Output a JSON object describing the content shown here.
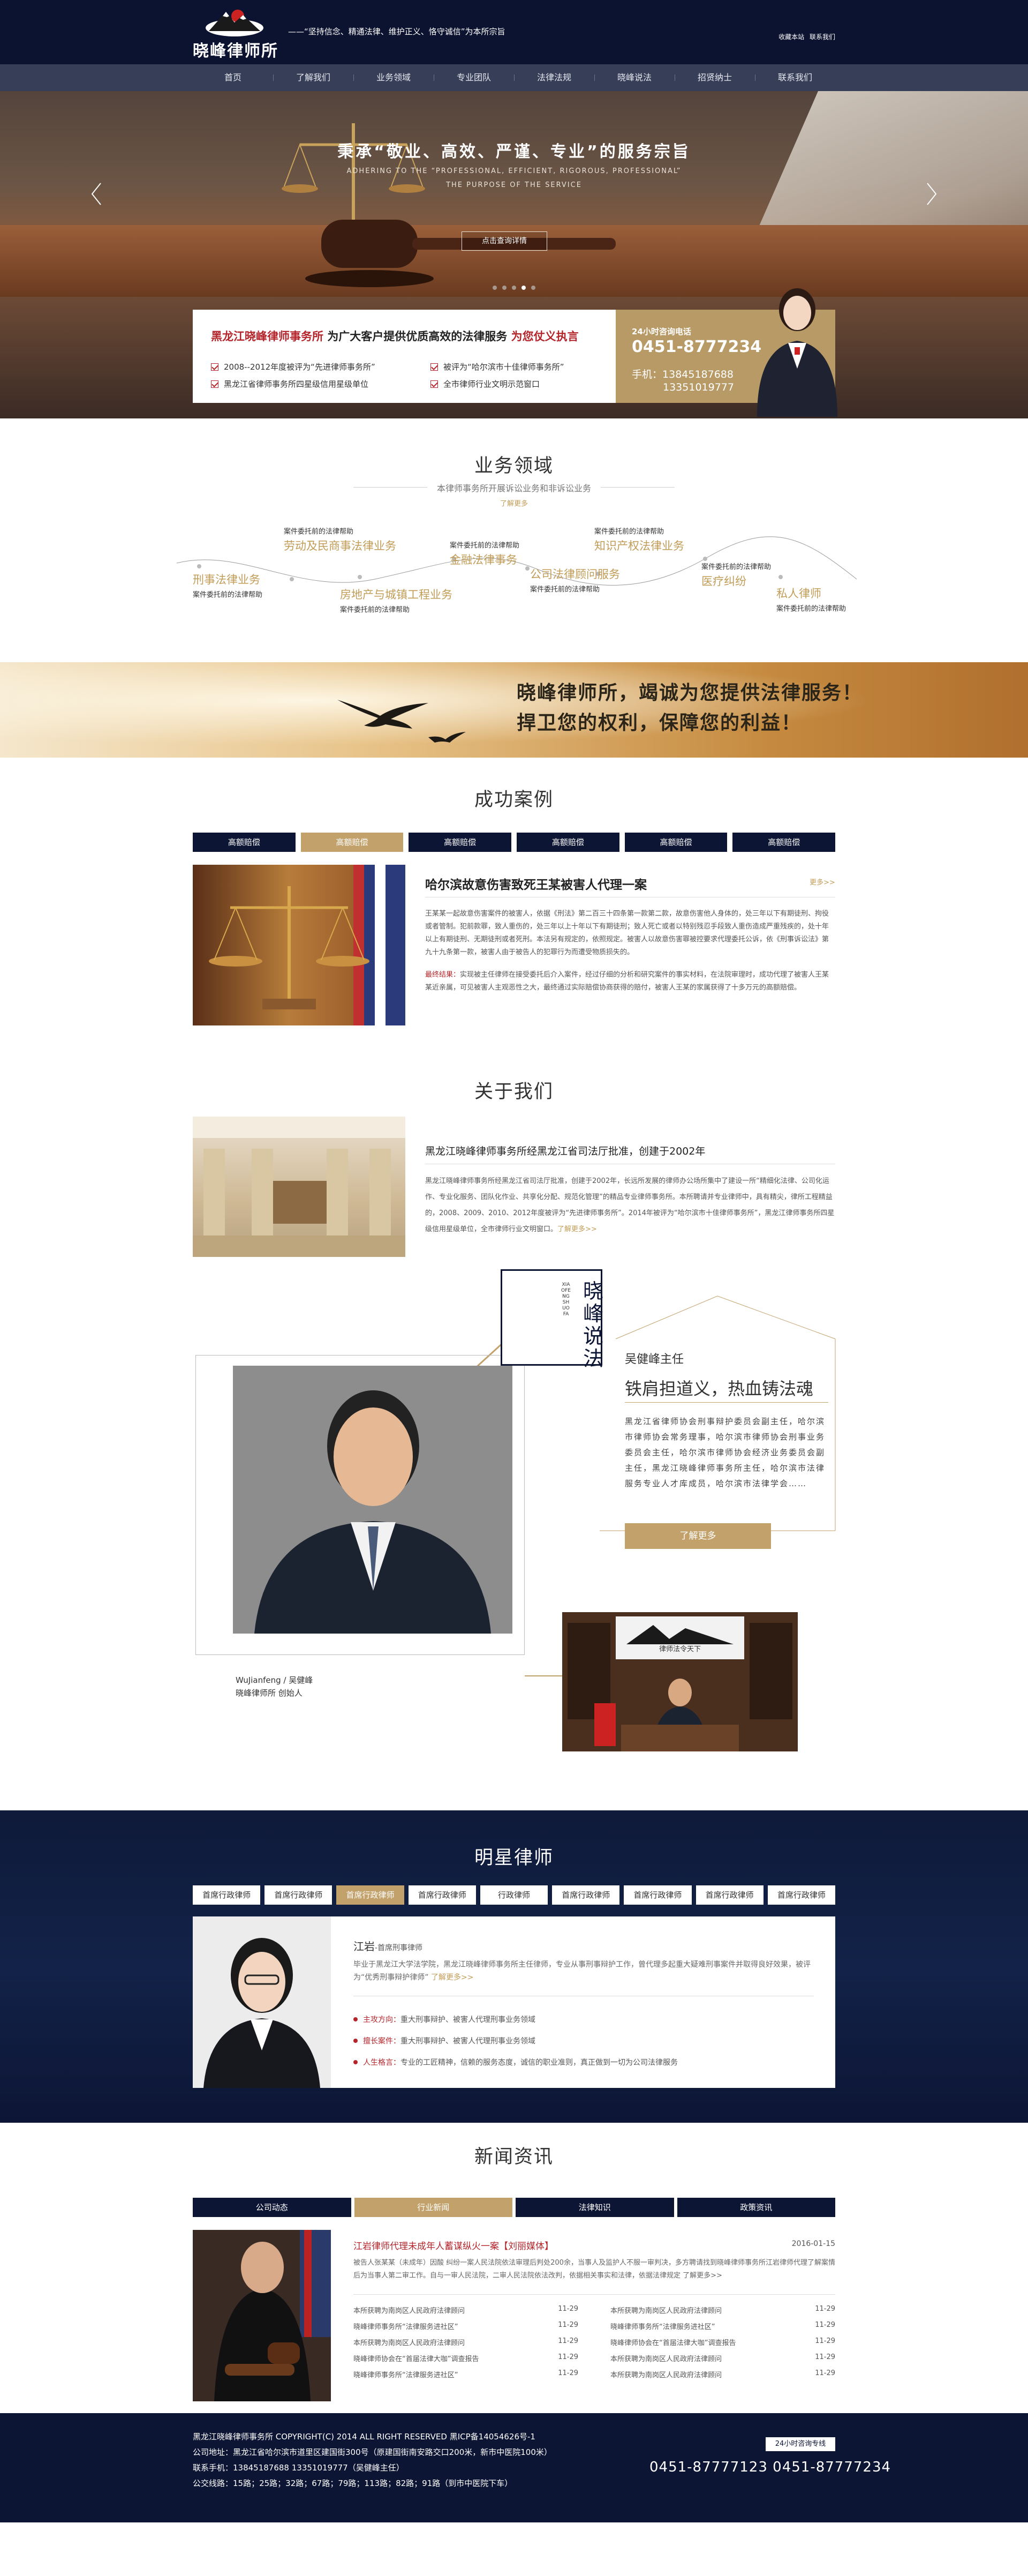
{
  "header": {
    "logo_name": "晓峰律师所",
    "slogan": "——“坚持信念、精通法律、维护正义、恪守诚信”为本所宗旨",
    "favorites": "收藏本站",
    "contact_us": "联系我们"
  },
  "nav": [
    "首页",
    "了解我们",
    "业务领域",
    "专业团队",
    "法律法规",
    "晓峰说法",
    "招贤纳士",
    "联系我们"
  ],
  "banner": {
    "title": "秉承“敬业、高效、严谨、专业”的服务宗旨",
    "en1": "ADHERING TO THE “PROFESSIONAL, EFFICIENT, RIGOROUS, PROFESSIONAL”",
    "en2": "THE PURPOSE OF THE SERVICE",
    "button": "点击查询详情"
  },
  "info": {
    "heading_red": "黑龙江晓峰律师事务所",
    "heading_mid": "为广大客户提供优质高效的法律服务",
    "heading_red2": "为您仗义执言",
    "items": [
      "2008--2012年度被评为“先进律师事务所”",
      "被评为“哈尔滨市十佳律师事务所”",
      "黑龙江省律师事务所四星级信用星级单位",
      "全市律师行业文明示范窗口"
    ],
    "hotline_label": "24小时咨询电话",
    "hotline": "0451-8777234",
    "mobile_label": "手机：",
    "mobile1": "13845187688",
    "mobile2": "13351019777"
  },
  "business": {
    "title": "业务领域",
    "subtitle": "本律师事务所开展诉讼业务和非诉讼业务",
    "more": "了解更多",
    "desc": "案件委托前的法律帮助",
    "items": [
      "刑事法律业务",
      "劳动及民商事法律业务",
      "房地产与城镇工程业务",
      "金融法律事务",
      "公司法律顾问服务",
      "知识产权法律业务",
      "医疗纠纷",
      "私人律师"
    ]
  },
  "motto": {
    "line1": "晓峰律师所，竭诚为您提供法律服务！",
    "line2": "捍卫您的权利，保障您的利益！"
  },
  "cases": {
    "title": "成功案例",
    "tabs": [
      "高额赔偿",
      "高额赔偿",
      "高额赔偿",
      "高额赔偿",
      "高额赔偿",
      "高额赔偿"
    ],
    "case_title": "哈尔滨故意伤害致死王某被害人代理一案",
    "more": "更多>>",
    "para1": "王某某一起故意伤害案件的被害人，依据《刑法》第二百三十四条第一款第二款，故意伤害他人身体的，处三年以下有期徒刑、拘役或者管制。犯前款罪，致人重伤的，处三年以上十年以下有期徒刑；致人死亡或者以特别残忍手段致人重伤造成严重残疾的，处十年以上有期徒刑、无期徒刑或者死刑。本法另有规定的，依照规定。被害人以故意伤害罪被控要求代理委托公诉，依《刑事诉讼法》第九十九条第一款，被害人由于被告人的犯罪行为而遭受物质损失的。",
    "result_label": "最终结果：",
    "result": "实现被主任律师在接受委托后介入案件，经过仔细的分析和研究案件的事实材料，在法院审理时，成功代理了被害人王某某近亲属，可见被害人主观恶性之大，最终通过实际赔偿协商获得的赔付，被害人王某的家属获得了十多万元的高额赔偿。"
  },
  "about": {
    "title": "关于我们",
    "heading": "黑龙江晓峰律师事务所经黑龙江省司法厅批准，创建于2002年",
    "para": "黑龙江晓峰律师事务所经黑龙江省司法厅批准，创建于2002年，长远所发展的律师办公场所集中了建设一所“精细化法律、公司化运作、专业化服务、团队化作业、共享化分配、规范化管理”的精品专业律师事务所。本所聘请并专业律师中，具有精尖，律所工程精益的，2008、2009、2010、2012年度被评为“先进律师事务所”。2014年被评为“哈尔滨市十佳律师事务所”，黑龙江律师事务所四星级信用星级单位，全市律师行业文明窗口。",
    "more": "了解更多>>"
  },
  "feature": {
    "vertical_title": "晓峰说法",
    "vertical_pinyin": "XIAOFENGSHUOFA",
    "name": "吴健峰主任",
    "motto": "铁肩担道义，热血铸法魂",
    "para": "黑龙江省律师协会刑事辩护委员会副主任，哈尔滨市律师协会常务理事，哈尔滨市律师协会刑事业务委员会主任，哈尔滨市律师协会经济业务委员会副主任，黑龙江晓峰律师事务所主任，哈尔滨市法律服务专业人才库成员，哈尔滨市法律学会……",
    "button": "了解更多",
    "sig_name": "WuJianfeng / 吴健峰",
    "sig_title": "晓峰律师所    创始人",
    "plaque": "律师法令天下"
  },
  "stars": {
    "title": "明星律师",
    "tabs": [
      "首席行政律师",
      "首席行政律师",
      "首席行政律师",
      "首席行政律师",
      "行政律师",
      "首席行政律师",
      "首席行政律师",
      "首席行政律师",
      "首席行政律师"
    ],
    "name": "江岩",
    "role": "-首席刑事律师",
    "intro": "毕业于黑龙江大学法学院，黑龙江晓峰律师事务所主任律师，专业从事刑事辩护工作，曾代理多起重大疑难刑事案件并取得良好效果，被评为“优秀刑事辩护律师”",
    "more": "了解更多>>",
    "items": [
      {
        "k": "主攻方向：",
        "v": "重大刑事辩护、被害人代理刑事业务领域"
      },
      {
        "k": "擅长案件：",
        "v": "重大刑事辩护、被害人代理刑事业务领域"
      },
      {
        "k": "人生格言：",
        "v": "专业的工匠精神，信赖的服务态度，诚信的职业准则，真正做到一切为公司法律服务"
      }
    ]
  },
  "news": {
    "title": "新闻资讯",
    "tabs": [
      "公司动态",
      "行业新闻",
      "法律知识",
      "政策资讯"
    ],
    "headline": "江岩律师代理未成年人蓄谋纵火一案【刘丽媒体】",
    "date": "2016-01-15",
    "para": "被告人张某某（未成年）因酸 纠纷一案人民法院依法审理后判处200余，当事人及监护人不服一审判决，多方聘请找到晓峰律师事务所江岩律师代理了解案情后为当事人第二审工作。自与一审人民法院，二审人民法院依法改判，依据相关事实和法律，依据法律规定 了解更多>>",
    "list_left": [
      {
        "t": "本所获聘为南岗区人民政府法律顾问",
        "d": "11-29"
      },
      {
        "t": "晓峰律师事务所“法律服务进社区”",
        "d": "11-29"
      },
      {
        "t": "本所获聘为南岗区人民政府法律顾问",
        "d": "11-29"
      },
      {
        "t": "晓峰律师协会在“首届法律大咖”调查报告",
        "d": "11-29"
      },
      {
        "t": "晓峰律师事务所“法律服务进社区”",
        "d": "11-29"
      }
    ],
    "list_right": [
      {
        "t": "本所获聘为南岗区人民政府法律顾问",
        "d": "11-29"
      },
      {
        "t": "晓峰律师事务所“法律服务进社区”",
        "d": "11-29"
      },
      {
        "t": "晓峰律师协会在“首届法律大咖”调查报告",
        "d": "11-29"
      },
      {
        "t": "本所获聘为南岗区人民政府法律顾问",
        "d": "11-29"
      },
      {
        "t": "本所获聘为南岗区人民政府法律顾问",
        "d": "11-29"
      }
    ]
  },
  "footer": {
    "line1": "黑龙江晓峰律师事务所 COPYRIGHT(C) 2014 ALL RIGHT RESERVED 黑ICP备14054626号-1",
    "line2": "公司地址：黑龙江省哈尔滨市道里区建国街300号（原建国街南安路交口200米，新市中医院100米）",
    "line3": "联系手机：13845187688  13351019777（吴健峰主任）",
    "line4": "公交线路：15路；25路；32路；67路；79路；113路；82路；91路（到市中医院下车）",
    "badge": "24小时咨询专线",
    "tel": "0451-87777123  0451-87777234"
  }
}
